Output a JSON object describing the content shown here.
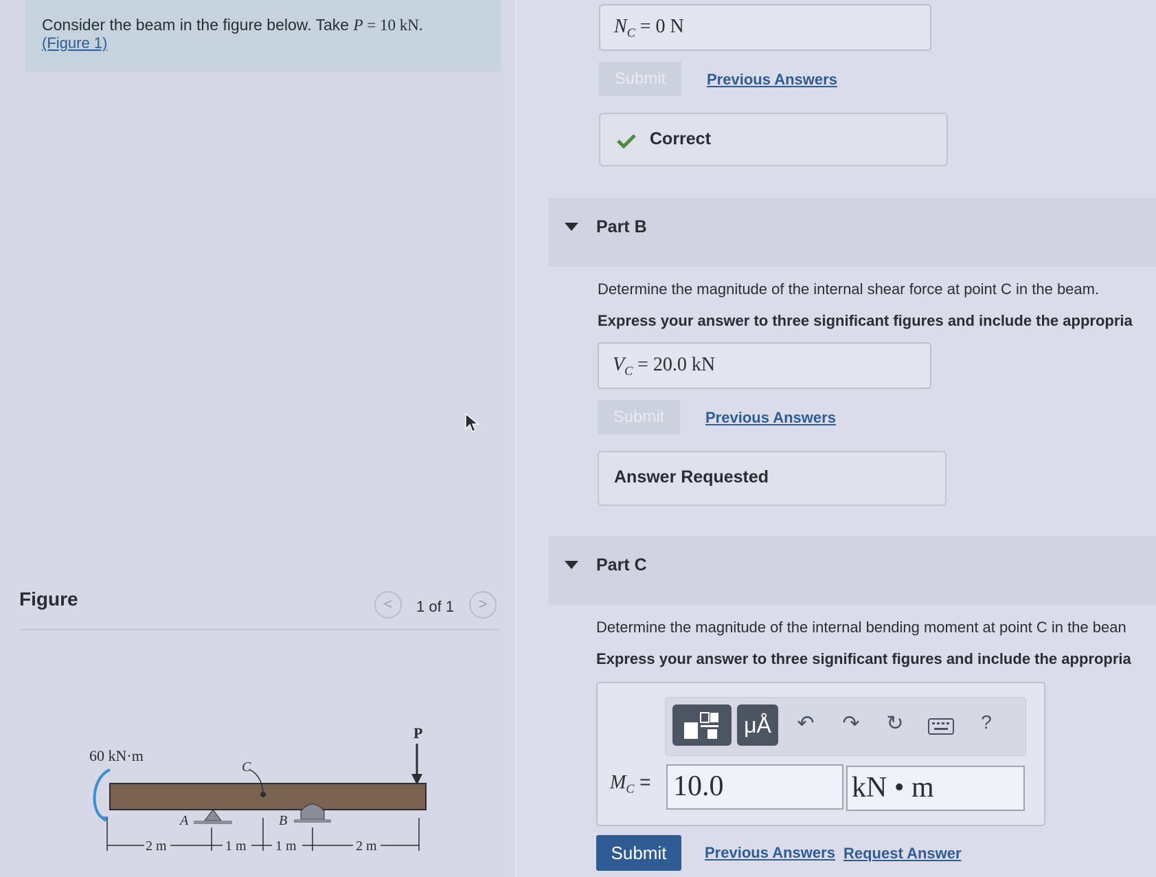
{
  "problem": {
    "prompt_prefix": "Consider the beam in the figure below. Take ",
    "prompt_var": "P",
    "prompt_rest": " = 10 kN.",
    "figure_link": "(Figure 1)"
  },
  "figure_panel": {
    "title": "Figure",
    "pager": "1 of 1",
    "prev_glyph": "<",
    "next_glyph": ">",
    "diagram": {
      "moment_label": "60 kN·m",
      "load_label": "P",
      "point_a": "A",
      "point_b": "B",
      "point_c": "C",
      "dim_1": "2 m",
      "dim_2": "1 m",
      "dim_3": "1 m",
      "dim_4": "2 m"
    }
  },
  "part_a": {
    "answer_var": "N",
    "answer_sub": "C",
    "answer_value": " = 0 N",
    "submit_label": "Submit",
    "previous_answers": "Previous Answers",
    "status_icon": "check-icon",
    "status_label": "Correct"
  },
  "part_b": {
    "title": "Part B",
    "question": "Determine the magnitude of the internal shear force at point C in the beam.",
    "instruction": "Express your answer to three significant figures and include the appropria",
    "answer_var": "V",
    "answer_sub": "C",
    "answer_value": " = 20.0 kN",
    "submit_label": "Submit",
    "previous_answers": "Previous Answers",
    "status_label": "Answer Requested"
  },
  "part_c": {
    "title": "Part C",
    "question": "Determine the magnitude of the internal bending moment at point C in the bean",
    "instruction": "Express your answer to three significant figures and include the appropria",
    "toolbar": {
      "templates_icon": "templates-icon",
      "units_label": "μÅ",
      "undo_icon": "undo-icon",
      "redo_icon": "redo-icon",
      "reset_icon": "reset-icon",
      "keyboard_icon": "keyboard-icon",
      "help_label": "?"
    },
    "answer_var": "M",
    "answer_sub": "C",
    "answer_eq": " =",
    "value": "10.0",
    "unit": "kN • m",
    "submit_label": "Submit",
    "previous_answers": "Previous Answers",
    "request_answer": "Request Answer"
  }
}
